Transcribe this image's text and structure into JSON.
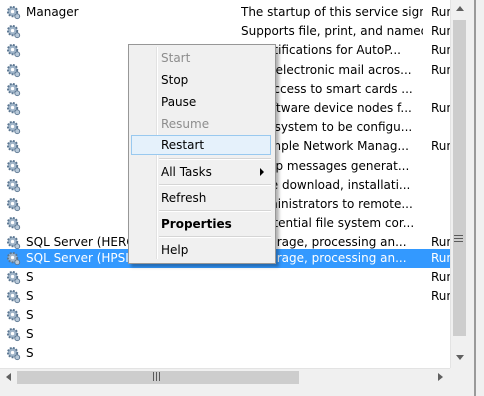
{
  "services": [
    {
      "name": "Manager",
      "desc": "The startup of this service signal...",
      "status": "Run"
    },
    {
      "name": "",
      "desc": "Supports file, print, and named-...",
      "status": "Run"
    },
    {
      "name": "",
      "desc": "es notifications for AutoP...",
      "status": "Run"
    },
    {
      "name": "",
      "desc": "ports electronic mail acros...",
      "status": "Run"
    },
    {
      "name": "",
      "desc": "ges access to smart cards ...",
      "status": ""
    },
    {
      "name": "",
      "desc": "es software device nodes f...",
      "status": "Run"
    },
    {
      "name": "",
      "desc": "s the system to be configu...",
      "status": ""
    },
    {
      "name": "",
      "desc": "es Simple Network Manag...",
      "status": "Run"
    },
    {
      "name": "",
      "desc": "es trap messages generat...",
      "status": ""
    },
    {
      "name": "",
      "desc": "es the download, installati...",
      "status": ""
    },
    {
      "name": "",
      "desc": "s administrators to remote...",
      "status": ""
    },
    {
      "name": "",
      "desc": "es potential file system cor...",
      "status": ""
    },
    {
      "name": "SQL Server (HEROK",
      "desc": "es storage, processing an...",
      "status": "Run"
    },
    {
      "name": "SQL Server (HPSIM)",
      "desc": "es storage, processing an...",
      "status": "Run"
    },
    {
      "name": "S",
      "desc": "",
      "status": "Run"
    },
    {
      "name": "S",
      "desc": "",
      "status": "Run"
    },
    {
      "name": "S",
      "desc": "",
      "status": ""
    },
    {
      "name": "S",
      "desc": "",
      "status": ""
    },
    {
      "name": "S",
      "desc": "",
      "status": ""
    }
  ],
  "context_menu": {
    "start": "Start",
    "stop": "Stop",
    "pause": "Pause",
    "resume": "Resume",
    "restart": "Restart",
    "all_tasks": "All Tasks",
    "refresh": "Refresh",
    "properties": "Properties",
    "help": "Help"
  },
  "colors": {
    "selection": "#3399ff",
    "menu_highlight": "#e5f1fb"
  }
}
